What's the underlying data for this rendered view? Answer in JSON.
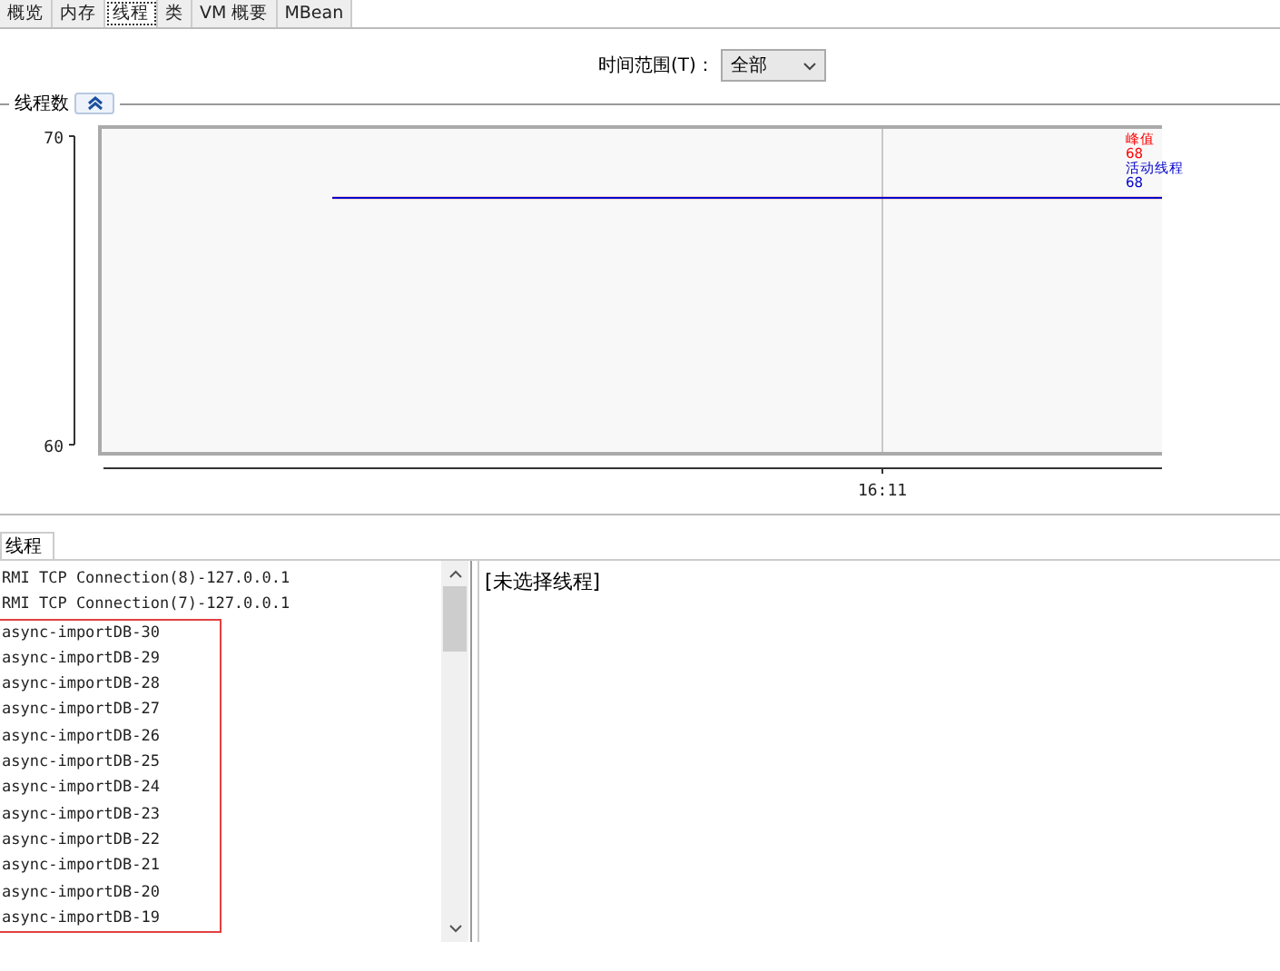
{
  "tabs": [
    {
      "label": "概览",
      "selected": false
    },
    {
      "label": "内存",
      "selected": false
    },
    {
      "label": "线程",
      "selected": true
    },
    {
      "label": "类",
      "selected": false
    },
    {
      "label": "VM 概要",
      "selected": false
    },
    {
      "label": "MBean",
      "selected": false
    }
  ],
  "time_range": {
    "label": "时间范围(T)：",
    "value": "全部"
  },
  "thread_count": {
    "title": "线程数",
    "expanded": true,
    "y_axis_labels": [
      "70",
      "60"
    ],
    "time_label": "16:11",
    "legend": [
      {
        "label": "峰值",
        "value": "68",
        "color": "#ff0000"
      },
      {
        "label": "活动线程",
        "value": "68",
        "color": "#0000cc"
      }
    ]
  },
  "bottom_tab": {
    "label": "线程",
    "selected": true
  },
  "threads": [
    {
      "name": "RMI TCP Connection(8)-127.0.0.1",
      "highlighted": false
    },
    {
      "name": "RMI TCP Connection(7)-127.0.0.1",
      "highlighted": false
    },
    {
      "name": "async-importDB-30",
      "highlighted": true
    },
    {
      "name": "async-importDB-29",
      "highlighted": true
    },
    {
      "name": "async-importDB-28",
      "highlighted": true
    },
    {
      "name": "async-importDB-27",
      "highlighted": true
    },
    {
      "name": "async-importDB-26",
      "highlighted": true
    },
    {
      "name": "async-importDB-25",
      "highlighted": true
    },
    {
      "name": "async-importDB-24",
      "highlighted": true
    },
    {
      "name": "async-importDB-23",
      "highlighted": true
    },
    {
      "name": "async-importDB-22",
      "highlighted": true
    },
    {
      "name": "async-importDB-21",
      "highlighted": true
    },
    {
      "name": "async-importDB-20",
      "highlighted": true
    },
    {
      "name": "async-importDB-19",
      "highlighted": true
    }
  ],
  "detail": "[未选择线程]"
}
